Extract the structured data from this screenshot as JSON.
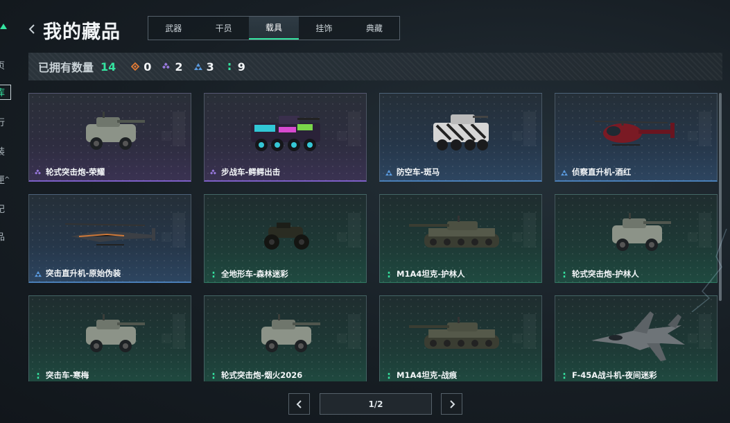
{
  "sidebar": {
    "items": [
      {
        "label": "页",
        "active": false
      },
      {
        "label": "库",
        "active": true
      },
      {
        "label": "行",
        "active": false
      },
      {
        "label": "装",
        "active": false
      },
      {
        "label": "匣",
        "active": false
      },
      {
        "label": "纪",
        "active": false
      },
      {
        "label": "品",
        "active": false
      }
    ]
  },
  "header": {
    "title": "我的藏品",
    "tabs": [
      {
        "label": "武器",
        "active": false
      },
      {
        "label": "干员",
        "active": false
      },
      {
        "label": "载具",
        "active": true
      },
      {
        "label": "挂饰",
        "active": false
      },
      {
        "label": "典藏",
        "active": false
      }
    ]
  },
  "owned": {
    "label": "已拥有数量",
    "total": "14",
    "rarities": [
      {
        "icon": "orange-diamond-icon",
        "color": "#e07a35",
        "count": "0"
      },
      {
        "icon": "purple-diamond-icon",
        "color": "#9a7ae0",
        "count": "2"
      },
      {
        "icon": "blue-triangle-icon",
        "color": "#5a9be0",
        "count": "3"
      },
      {
        "icon": "green-dots-icon",
        "color": "#35e3a0",
        "count": "9"
      }
    ]
  },
  "items": [
    {
      "name": "轮式突击炮-荣耀",
      "rarity": "purple",
      "icon": "purple-diamond-icon",
      "art": "armored-car"
    },
    {
      "name": "步战车-鳄鳄出击",
      "rarity": "purple",
      "icon": "purple-diamond-icon",
      "art": "ifv"
    },
    {
      "name": "防空车-斑马",
      "rarity": "blue",
      "icon": "blue-triangle-icon",
      "art": "aa-truck"
    },
    {
      "name": "侦察直升机-酒红",
      "rarity": "blue",
      "icon": "blue-triangle-icon",
      "art": "heli-small"
    },
    {
      "name": "突击直升机-原始伪装",
      "rarity": "blue",
      "icon": "blue-triangle-icon",
      "art": "heli-attack"
    },
    {
      "name": "全地形车-森林迷彩",
      "rarity": "green",
      "icon": "green-dots-icon",
      "art": "atv"
    },
    {
      "name": "M1A4坦克-护林人",
      "rarity": "green",
      "icon": "green-dots-icon",
      "art": "tank"
    },
    {
      "name": "轮式突击炮-护林人",
      "rarity": "green",
      "icon": "green-dots-icon",
      "art": "armored-car"
    },
    {
      "name": "突击车-寒梅",
      "rarity": "green",
      "icon": "green-dots-icon",
      "art": "armored-car"
    },
    {
      "name": "轮式突击炮-烟火2026",
      "rarity": "green",
      "icon": "green-dots-icon",
      "art": "armored-car"
    },
    {
      "name": "M1A4坦克-战痕",
      "rarity": "green",
      "icon": "green-dots-icon",
      "art": "tank"
    },
    {
      "name": "F-45A战斗机-夜间迷彩",
      "rarity": "green",
      "icon": "green-dots-icon",
      "art": "jet"
    }
  ],
  "pagination": {
    "indicator": "1/2"
  }
}
